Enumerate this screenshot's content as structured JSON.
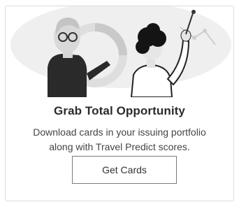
{
  "card": {
    "title": "Grab Total Opportunity",
    "description_line1": "Download cards in your issuing portfolio",
    "description_line2": "along with Travel Predict scores.",
    "button_label": "Get Cards"
  },
  "icons": {
    "illustration": "people-analyzing-chart-illustration"
  }
}
